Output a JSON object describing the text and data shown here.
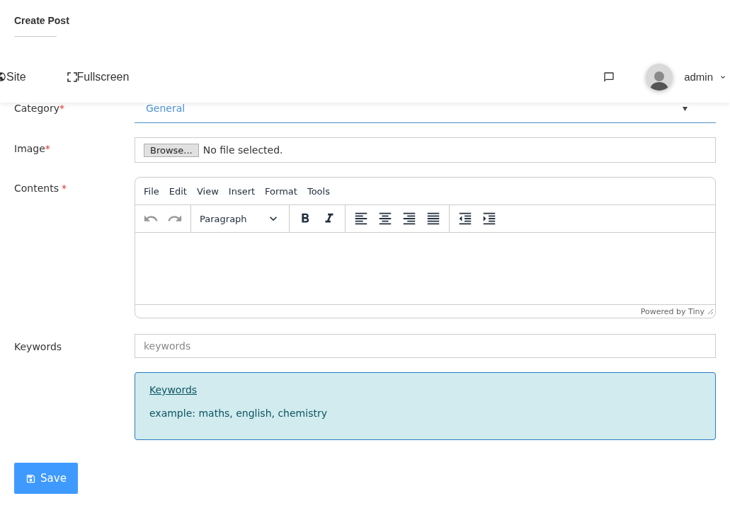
{
  "page_title": "Create Post",
  "navbar": {
    "links": [
      {
        "kind": "site",
        "label": "Site"
      },
      {
        "kind": "fullscreen",
        "label": "Fullscreen"
      }
    ],
    "user": "admin"
  },
  "form": {
    "category": {
      "label": "Category",
      "marker": "*",
      "value": "General"
    },
    "image": {
      "label": "Image",
      "marker": "*",
      "button": "Browse...",
      "status": "No file selected."
    },
    "contents": {
      "label": "Contents",
      "marker": "*",
      "menu": [
        "File",
        "Edit",
        "View",
        "Insert",
        "Format",
        "Tools"
      ],
      "undo_disabled": true,
      "redo_disabled": true,
      "block_format": "Paragraph",
      "footer": "Powered by Tiny"
    },
    "keywords": {
      "label": "Keywords",
      "placeholder": "keywords"
    },
    "hint": {
      "title": "Keywords",
      "text": "example: maths, english, chemistry"
    }
  },
  "save_button": "Save"
}
